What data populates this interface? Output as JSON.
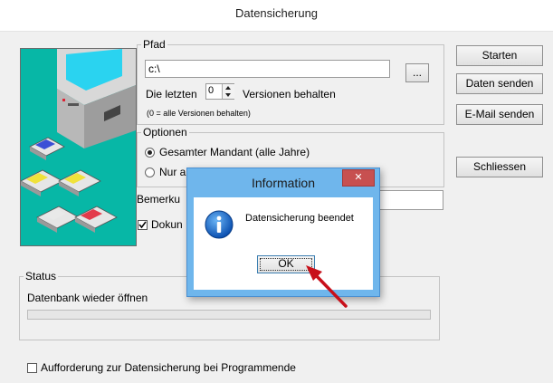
{
  "window": {
    "title": "Datensicherung"
  },
  "pfad": {
    "legend": "Pfad",
    "path_value": "c:\\",
    "browse_label": "...",
    "versions_prefix": "Die letzten",
    "versions_value": "0",
    "versions_suffix": "Versionen behalten",
    "note": "(0 = alle Versionen behalten)"
  },
  "optionen": {
    "legend": "Optionen",
    "option1_label": "Gesamter Mandant (alle Jahre)",
    "option2_label": "Nur a"
  },
  "bemerkung": {
    "label": "Bemerku"
  },
  "dokument": {
    "label": "Dokun"
  },
  "buttons": {
    "starten": "Starten",
    "daten_senden": "Daten senden",
    "email_senden": "E-Mail senden",
    "schliessen": "Schliessen"
  },
  "status": {
    "legend": "Status",
    "text": "Datenbank wieder öffnen",
    "progress": 0
  },
  "footer": {
    "checkbox_label": "Aufforderung zur Datensicherung bei Programmende"
  },
  "dialog": {
    "title": "Information",
    "close_glyph": "✕",
    "message": "Datensicherung beendet",
    "ok_label": "OK"
  },
  "colors": {
    "picture_bg": "#07b7a6",
    "dialog_frame": "#6fb6ec",
    "close_button": "#c75050",
    "arrow": "#e0101a"
  }
}
